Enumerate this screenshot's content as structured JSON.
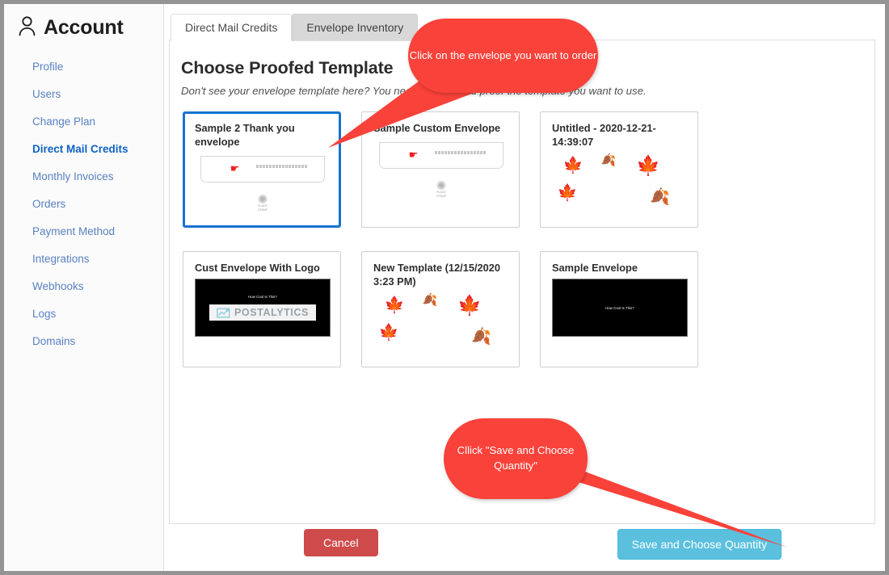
{
  "sidebar": {
    "account_title": "Account",
    "account_icon": "user-icon",
    "items": [
      {
        "label": "Profile",
        "active": false
      },
      {
        "label": "Users",
        "active": false
      },
      {
        "label": "Change Plan",
        "active": false
      },
      {
        "label": "Direct Mail Credits",
        "active": true
      },
      {
        "label": "Monthly Invoices",
        "active": false
      },
      {
        "label": "Orders",
        "active": false
      },
      {
        "label": "Payment Method",
        "active": false
      },
      {
        "label": "Integrations",
        "active": false
      },
      {
        "label": "Webhooks",
        "active": false
      },
      {
        "label": "Logs",
        "active": false
      },
      {
        "label": "Domains",
        "active": false
      }
    ]
  },
  "tabs": [
    {
      "label": "Direct Mail Credits",
      "active": true
    },
    {
      "label": "Envelope Inventory",
      "active": false
    }
  ],
  "main": {
    "heading": "Choose Proofed Template",
    "subtitle": "Don't see your envelope template here? You need to open and proof the template you want to use."
  },
  "templates": [
    {
      "name": "Sample 2 Thank you envelope",
      "selected": true,
      "thumb_type": "envelope",
      "thumb_caption": "Get Rapid Insight Into Just How Amazing YOU!",
      "stamp_label": "PLACE\nSTAMP"
    },
    {
      "name": "Sample Custom Envelope",
      "selected": false,
      "thumb_type": "envelope",
      "thumb_caption": "Get Rapid Insight Into Just How Amazing YOU!",
      "stamp_label": "PLACE\nSTAMP"
    },
    {
      "name": "Untitled - 2020-12-21-14:39:07",
      "selected": false,
      "thumb_type": "leaves"
    },
    {
      "name": "Cust Envelope With Logo",
      "selected": false,
      "thumb_type": "black-logo",
      "thumb_caption": "How Cool Is This?",
      "logo_text": "POSTALYTICS"
    },
    {
      "name": "New Template (12/15/2020 3:23 PM)",
      "selected": false,
      "thumb_type": "leaves"
    },
    {
      "name": "Sample Envelope",
      "selected": false,
      "thumb_type": "black",
      "thumb_caption": "How Cool Is This?"
    }
  ],
  "footer": {
    "cancel_label": "Cancel",
    "save_label": "Save and Choose Quantity"
  },
  "callouts": [
    {
      "text": "Click on the envelope you want to order"
    },
    {
      "text": "Cllick \"Save and Choose Quantity\""
    }
  ],
  "colors": {
    "accent_blue": "#1573d1",
    "nav_link": "#5881c1",
    "nav_active": "#1062c4",
    "callout_red": "#f9423a",
    "cancel_red": "#cf4b4b",
    "save_blue": "#5bc0de",
    "frame_gray": "#949494"
  }
}
